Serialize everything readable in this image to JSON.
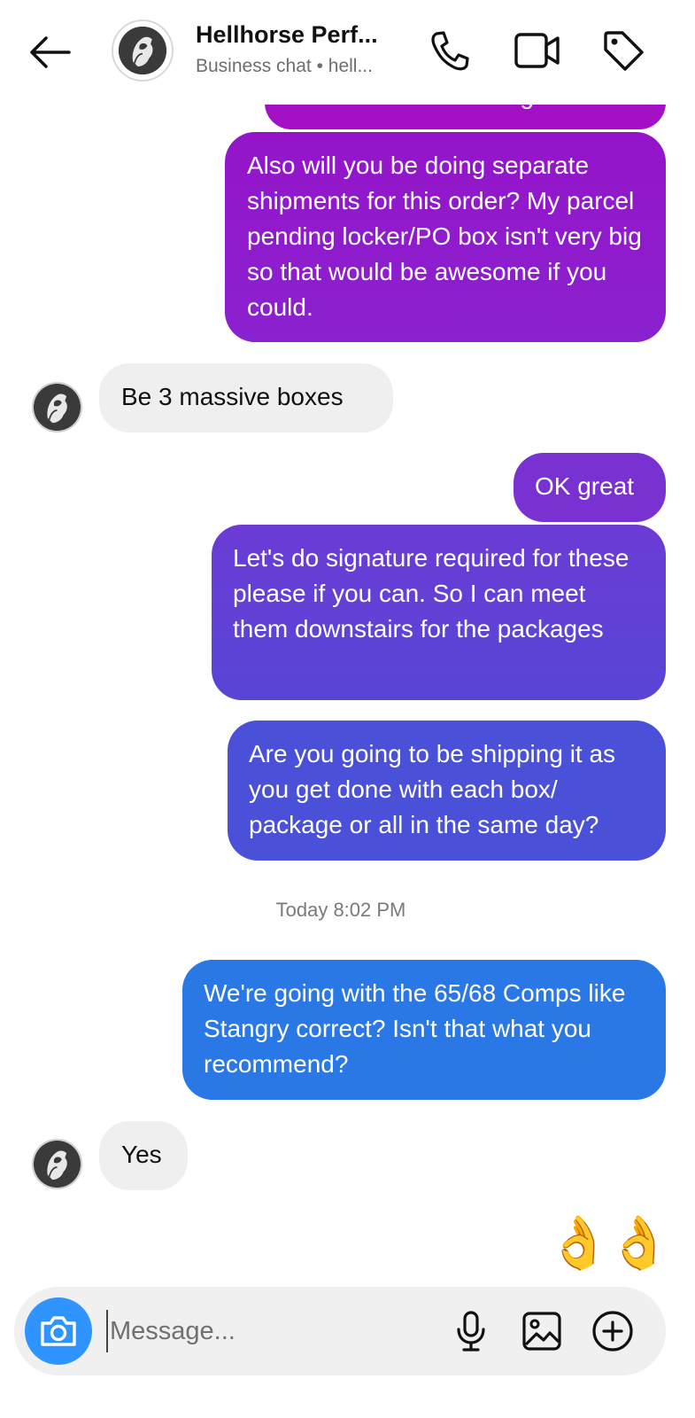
{
  "header": {
    "name": "Hellhorse Perf...",
    "subtitle": "Business chat • hell..."
  },
  "icons": {
    "back": "arrow-left-icon",
    "call": "phone-icon",
    "video": "video-camera-icon",
    "tag": "tag-icon",
    "camera": "camera-icon",
    "mic": "microphone-icon",
    "gallery": "image-icon",
    "plus": "plus-circle-icon"
  },
  "colors": {
    "purple_top": "#a012c6",
    "purple_mid": "#7d2ed3",
    "violet": "#5a44d6",
    "indigo": "#4b4fd8",
    "blue": "#2a78e6",
    "incoming_bg": "#efefef",
    "camera_blue": "#2f94ff"
  },
  "messages": [
    {
      "sender": "me",
      "text": "address though."
    },
    {
      "sender": "me",
      "text": "Also will you be doing separate shipments for this order? My parcel pending locker/PO box isn't very big so that would be awesome if you could."
    },
    {
      "sender": "them",
      "text": "Be 3 massive boxes"
    },
    {
      "sender": "me",
      "text": "OK great"
    },
    {
      "sender": "me",
      "text": "Let's do signature required for these please if you can. So I can meet them downstairs for the packages"
    },
    {
      "sender": "me",
      "text": "Are you going to be shipping it as you get done with each box/ package or all in the same day?"
    },
    {
      "sender": "me",
      "text": "We're going with the 65/68 Comps like Stangry correct? Isn't that what you recommend?"
    },
    {
      "sender": "them",
      "text": "Yes"
    }
  ],
  "timestamp": "Today 8:02 PM",
  "reaction": "👌👌",
  "composer": {
    "placeholder": "Message..."
  }
}
